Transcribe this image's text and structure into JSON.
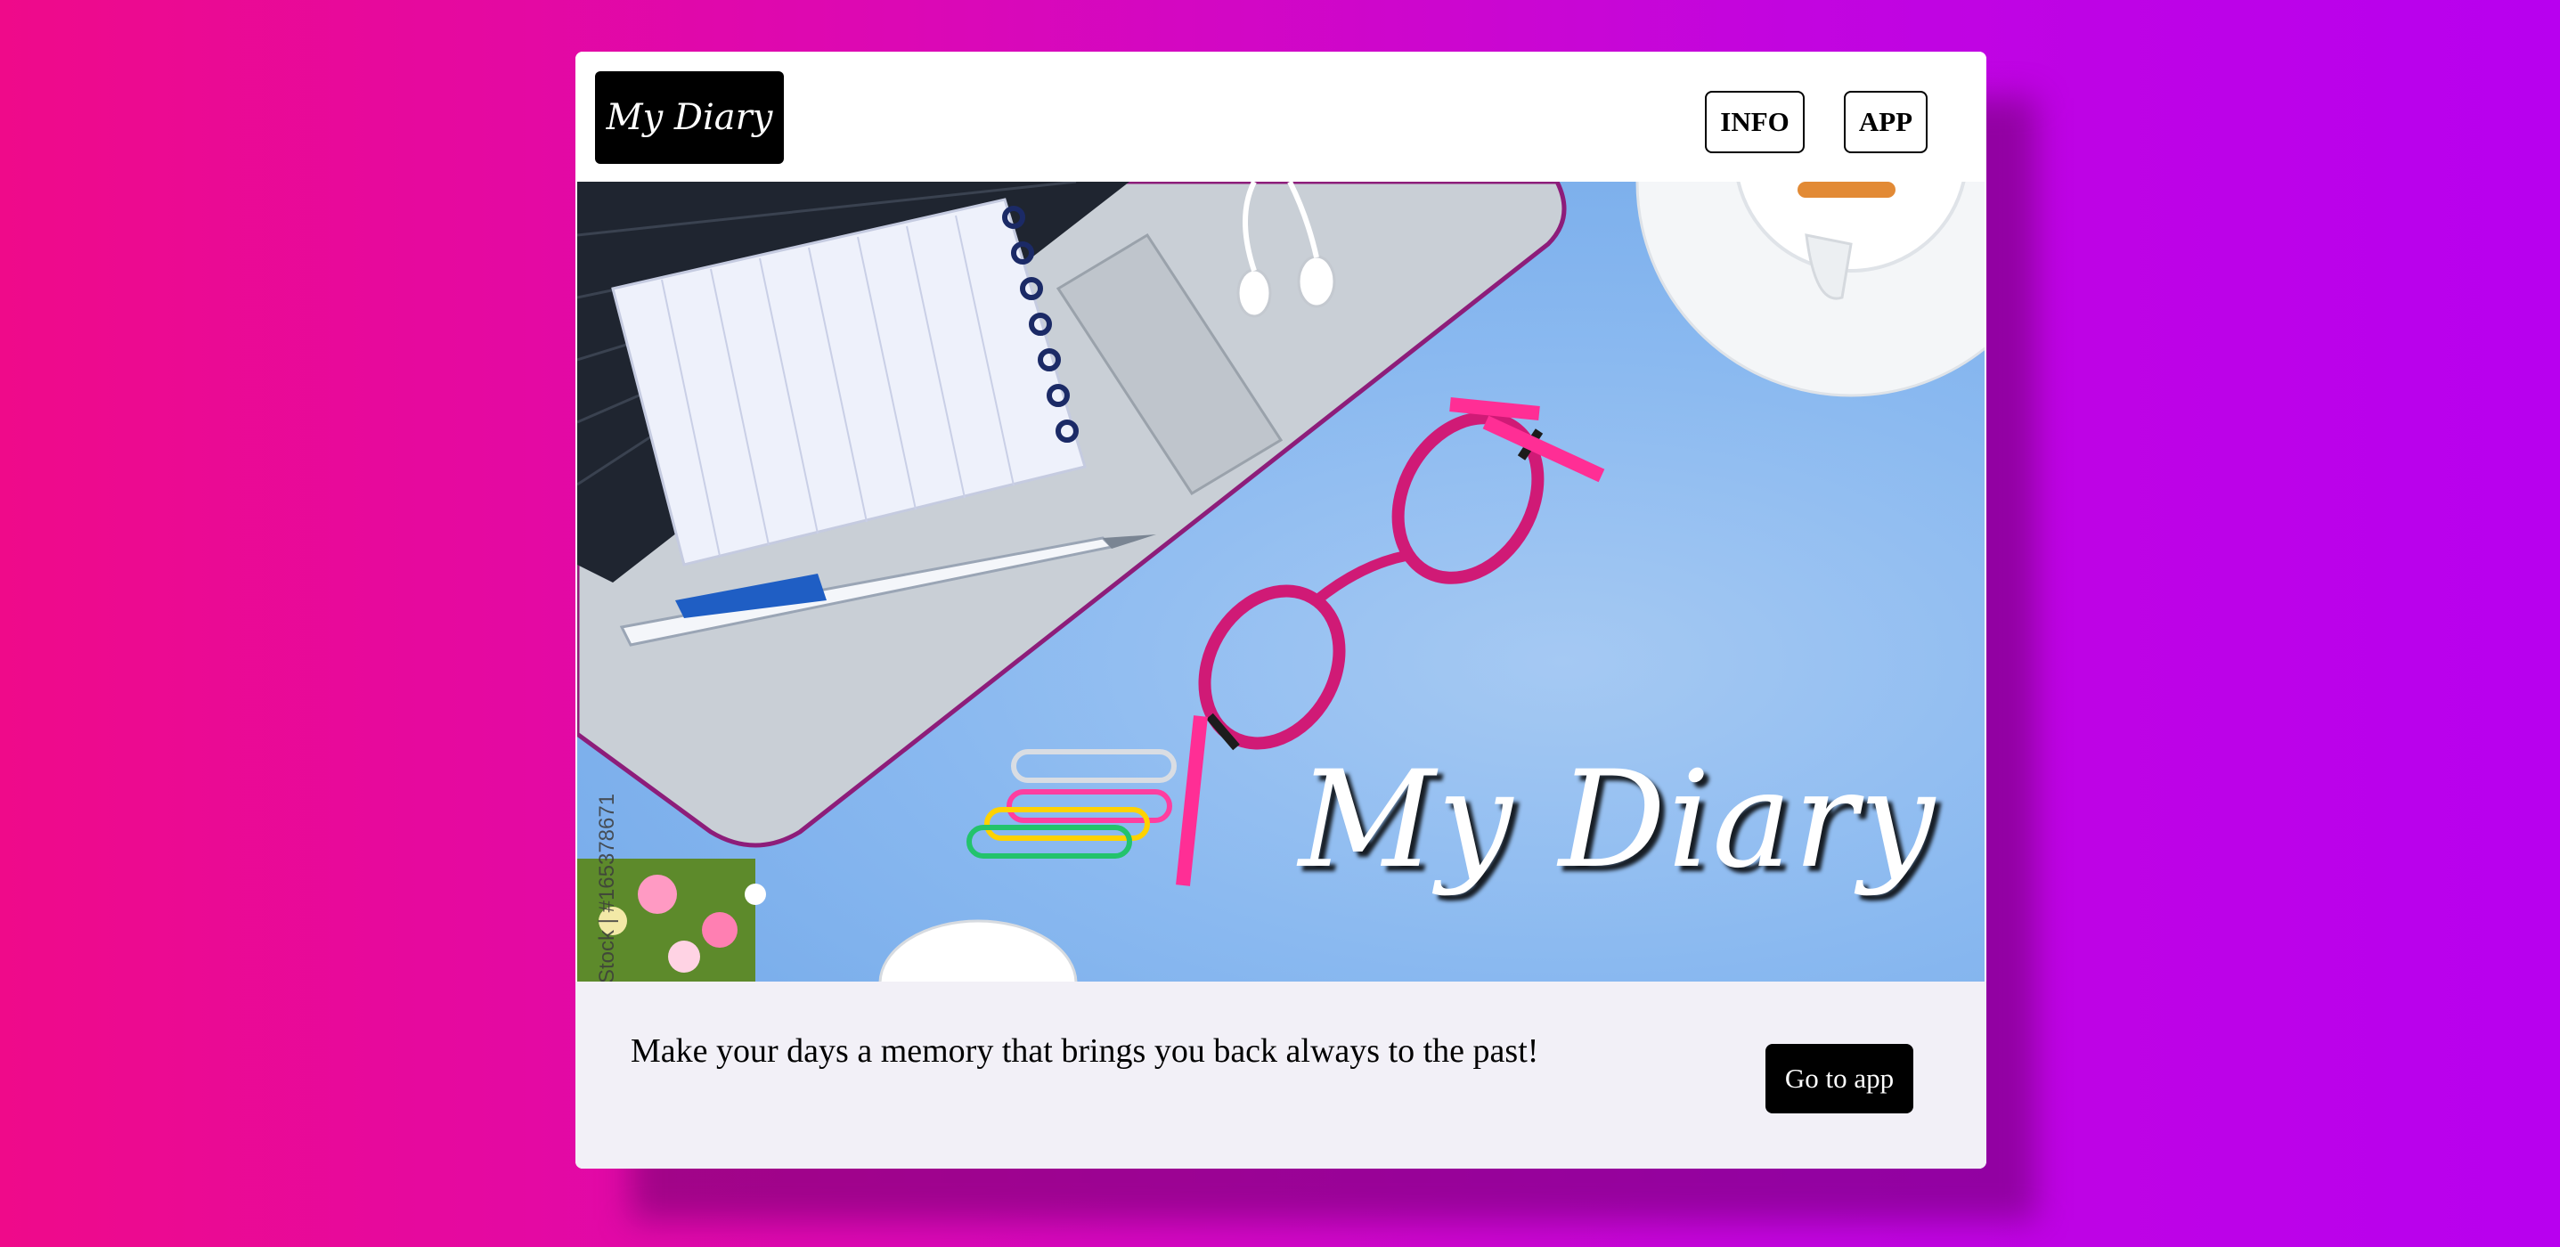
{
  "header": {
    "logo_text": "My Diary",
    "nav": [
      {
        "label": "INFO"
      },
      {
        "label": "APP"
      }
    ]
  },
  "hero": {
    "title": "My Diary",
    "watermark": "Stock | #165378671"
  },
  "footer": {
    "tagline": "Make your days a memory that brings you back always to the past!",
    "cta_label": "Go to app"
  },
  "colors": {
    "background_gradient_start": "#ef0a8a",
    "background_gradient_end": "#b800ef",
    "button_dark": "#000000",
    "footer_background": "#f2f0f7"
  }
}
